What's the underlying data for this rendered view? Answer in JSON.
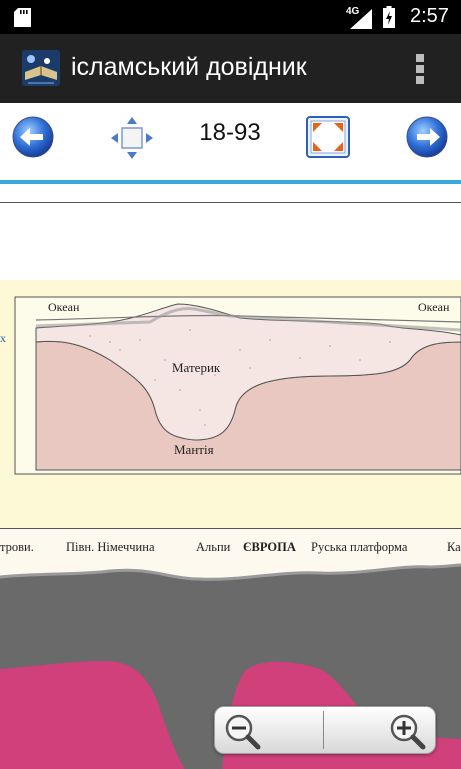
{
  "status_bar": {
    "network": "4G",
    "time": "2:57"
  },
  "action_bar": {
    "title": "ісламський довідник"
  },
  "toolbar": {
    "page_indicator": "18-93"
  },
  "figure": {
    "ocean_left": "Океан",
    "ocean_right": "Океан",
    "continent": "Материк",
    "mantle": "Мантія",
    "side_fragment": "х"
  },
  "photo": {
    "labels": [
      "трови.",
      "Півн. Німеччина",
      "Альпи",
      "ЄВРОПА",
      "Руська платформа",
      "Ка"
    ]
  },
  "colors": {
    "accent": "#36a8dc",
    "action_bar": "#212121",
    "mantle": "#e8c8c0",
    "continent": "#f5e6e4",
    "pink_layer": "#d0407a"
  }
}
